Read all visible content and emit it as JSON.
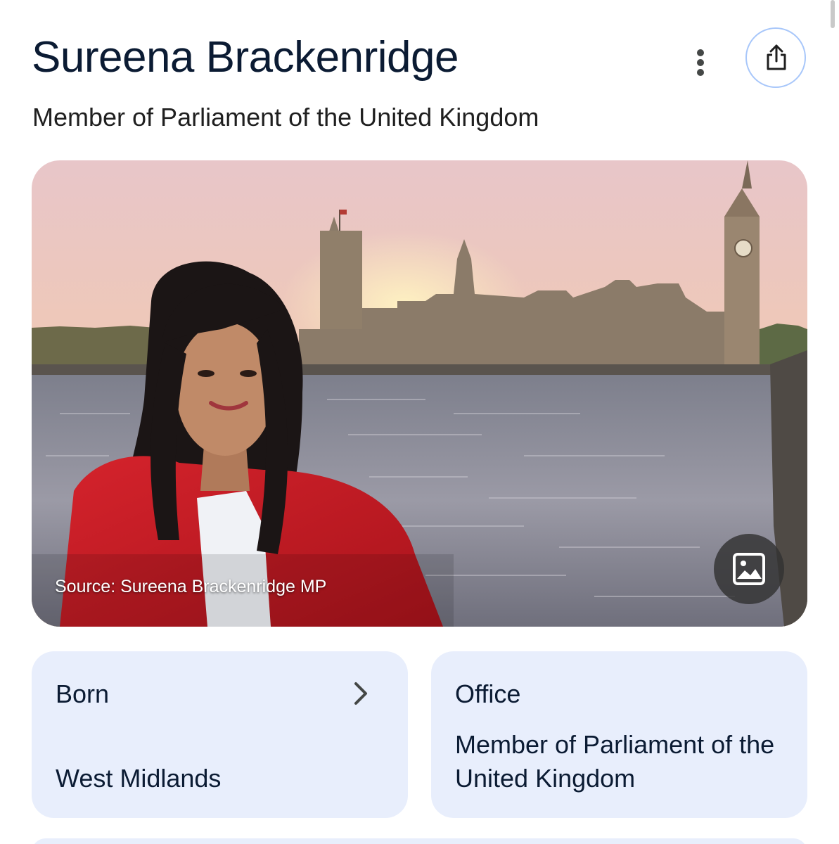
{
  "header": {
    "title": "Sureena Brackenridge",
    "subtitle": "Member of Parliament of the United Kingdom",
    "menu_icon": "more-vertical-icon",
    "share_icon": "share-icon"
  },
  "photo": {
    "caption": "Source: Sureena Brackenridge MP",
    "image_button_icon": "image-icon"
  },
  "cards": {
    "born": {
      "label": "Born",
      "value": "West Midlands",
      "chevron_icon": "chevron-right-icon"
    },
    "office": {
      "label": "Office",
      "value": "Member of Parliament of the United Kingdom"
    }
  },
  "colors": {
    "card_background": "#e8eefc",
    "title_text": "#0b1b33",
    "share_border": "#a8c7fa"
  }
}
